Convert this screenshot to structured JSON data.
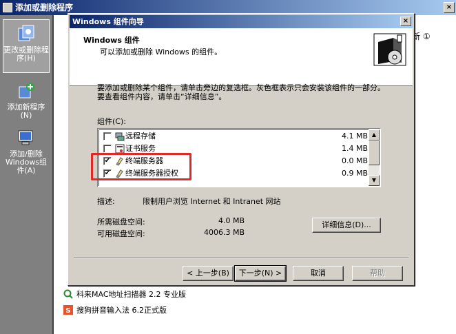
{
  "background_window": {
    "title": "添加或删除程序",
    "close_glyph": "×",
    "sidebar": [
      {
        "label": "更改或删除程序(H)",
        "icon": "change-remove-programs-icon",
        "active": true
      },
      {
        "label": "添加新程序(N)",
        "icon": "add-new-programs-icon",
        "active": false
      },
      {
        "label": "添加/删除Windows组件(A)",
        "icon": "windows-components-icon",
        "active": false
      }
    ],
    "right_fragment": "新 ①",
    "list_items": [
      {
        "name": "科来MAC地址扫描器 2.2 专业版",
        "icon": "scanner-icon"
      },
      {
        "name": "搜狗拼音输入法 6.2正式版",
        "icon": "sogou-icon"
      }
    ]
  },
  "dialog": {
    "title": "Windows 组件向导",
    "close_glyph": "×",
    "header_title": "Windows 组件",
    "header_subtitle": "可以添加或删除 Windows 的组件。",
    "instructions": "要添加或删除某个组件，请单击旁边的复选框。灰色框表示只会安装该组件的一部分。要查看组件内容，请单击“详细信息”。",
    "components_label": "组件(C):",
    "components": [
      {
        "name": "远程存储",
        "size": "4.1 MB",
        "checked": false,
        "icon": "remote-storage-icon"
      },
      {
        "name": "证书服务",
        "size": "1.4 MB",
        "checked": false,
        "icon": "certificate-services-icon"
      },
      {
        "name": "终端服务器",
        "size": "0.0 MB",
        "checked": true,
        "icon": "terminal-server-icon"
      },
      {
        "name": "终端服务器授权",
        "size": "0.9 MB",
        "checked": true,
        "icon": "terminal-licensing-icon"
      }
    ],
    "check_glyph": "✔",
    "description_label": "描述:",
    "description": "限制用户浏览 Internet 和 Intranet 网站",
    "space_required_label": "所需磁盘空间:",
    "space_required": "4.0 MB",
    "space_available_label": "可用磁盘空间:",
    "space_available": "4006.3 MB",
    "details_button": "详细信息(D)...",
    "back_button": "< 上一步(B)",
    "next_button": "下一步(N) >",
    "cancel_button": "取消",
    "help_button": "帮助",
    "highlight_color": "#e02828"
  }
}
